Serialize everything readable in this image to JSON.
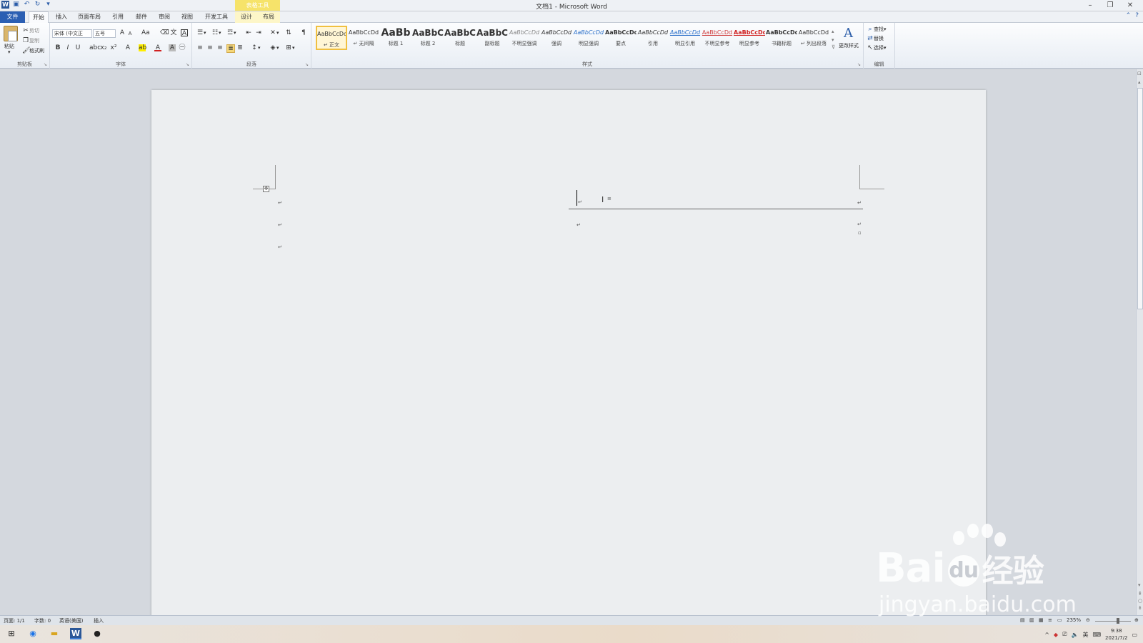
{
  "window": {
    "title": "文档1 - Microsoft Word",
    "context_tab_group": "表格工具"
  },
  "tabs": [
    {
      "label": "文件"
    },
    {
      "label": "开始"
    },
    {
      "label": "插入"
    },
    {
      "label": "页面布局"
    },
    {
      "label": "引用"
    },
    {
      "label": "邮件"
    },
    {
      "label": "审阅"
    },
    {
      "label": "视图"
    },
    {
      "label": "开发工具"
    },
    {
      "label": "设计"
    },
    {
      "label": "布局"
    }
  ],
  "ribbon": {
    "clipboard": {
      "paste": "粘贴",
      "cut": "剪切",
      "copy": "复制",
      "format_painter": "格式刷",
      "label": "剪贴板"
    },
    "font": {
      "font_name": "宋体 (中文正",
      "font_size": "五号",
      "label": "字体"
    },
    "paragraph": {
      "label": "段落"
    },
    "styles": {
      "label": "样式",
      "items": [
        {
          "sample": "AaBbCcDd",
          "name": "↵ 正文"
        },
        {
          "sample": "AaBbCcDd",
          "name": "↵ 无间隔"
        },
        {
          "sample": "AaBb",
          "name": "标题 1"
        },
        {
          "sample": "AaBbC",
          "name": "标题 2"
        },
        {
          "sample": "AaBbC",
          "name": "标题"
        },
        {
          "sample": "AaBbC",
          "name": "副标题"
        },
        {
          "sample": "AaBbCcDd",
          "name": "不明显强调"
        },
        {
          "sample": "AaBbCcDd",
          "name": "强调"
        },
        {
          "sample": "AaBbCcDd",
          "name": "明显强调"
        },
        {
          "sample": "AaBbCcDd",
          "name": "要点"
        },
        {
          "sample": "AaBbCcDd",
          "name": "引用"
        },
        {
          "sample": "AaBbCcDd",
          "name": "明显引用"
        },
        {
          "sample": "AaBbCcDd",
          "name": "不明显参考"
        },
        {
          "sample": "AaBbCcDd",
          "name": "明显参考"
        },
        {
          "sample": "AaBbCcDd",
          "name": "书籍标题"
        },
        {
          "sample": "AaBbCcDd",
          "name": "↵ 列出段落"
        }
      ],
      "change_styles": "更改样式"
    },
    "editing": {
      "find": "查找",
      "replace": "替换",
      "select": "选择",
      "label": "编辑"
    }
  },
  "status": {
    "page": "页面: 1/1",
    "words": "字数: 0",
    "language": "英语(美国)",
    "mode": "插入",
    "zoom": "235%"
  },
  "taskbar": {
    "time": "9:38",
    "date": "2021/7/2",
    "ime": "英"
  },
  "watermark": {
    "main": "Bai",
    "main2": "经验",
    "sub": "jingyan.baidu.com"
  },
  "colors": {
    "file_tab": "#2b5fb3",
    "context_tab": "#f6e36a",
    "selected_style_border": "#f0c040"
  }
}
